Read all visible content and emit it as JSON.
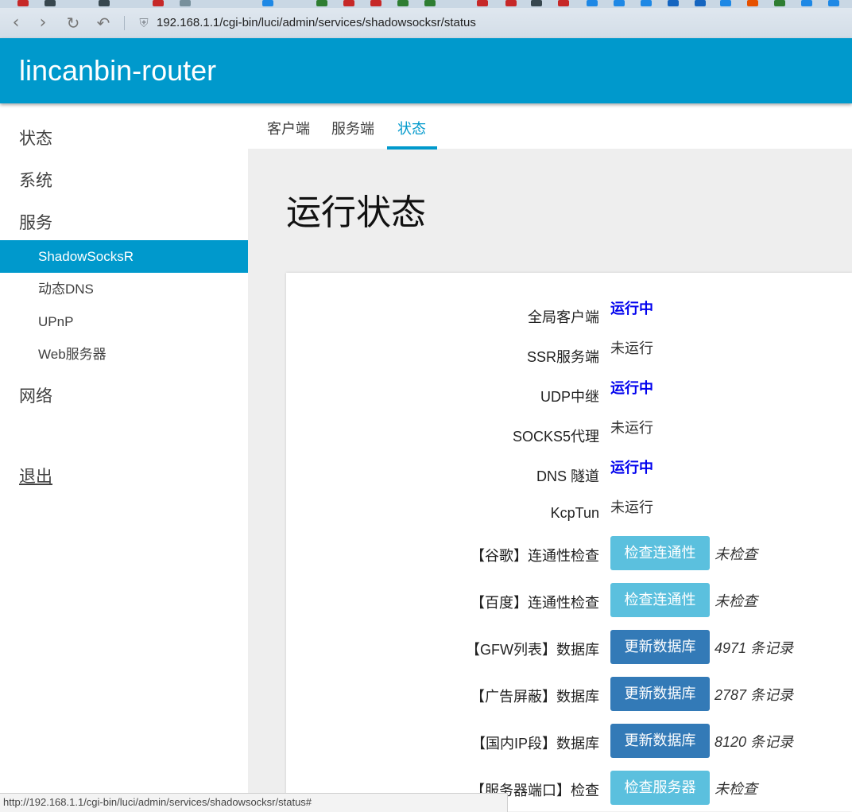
{
  "browser": {
    "url": "192.168.1.1/cgi-bin/luci/admin/services/shadowsocksr/status",
    "status_url": "http://192.168.1.1/cgi-bin/luci/admin/services/shadowsocksr/status#",
    "icons": [
      "back-icon",
      "forward-icon",
      "reload-icon",
      "undo-icon",
      "shield-icon"
    ]
  },
  "header": {
    "brand": "lincanbin-router",
    "color": "#0099cc"
  },
  "sidebar": {
    "items": [
      {
        "label": "状态"
      },
      {
        "label": "系统"
      },
      {
        "label": "服务"
      }
    ],
    "sub_items": [
      {
        "label": "ShadowSocksR",
        "active": true
      },
      {
        "label": "动态DNS"
      },
      {
        "label": "UPnP"
      },
      {
        "label": "Web服务器"
      }
    ],
    "network": "网络",
    "logout": "退出"
  },
  "tabs": [
    {
      "label": "客户端"
    },
    {
      "label": "服务端"
    },
    {
      "label": "状态",
      "active": true
    }
  ],
  "page_title": "运行状态",
  "status_rows": [
    {
      "label": "全局客户端",
      "value": "运行中",
      "state": "running"
    },
    {
      "label": "SSR服务端",
      "value": "未运行",
      "state": "stopped"
    },
    {
      "label": "UDP中继",
      "value": "运行中",
      "state": "running"
    },
    {
      "label": "SOCKS5代理",
      "value": "未运行",
      "state": "stopped"
    },
    {
      "label": "DNS 隧道",
      "value": "运行中",
      "state": "running"
    },
    {
      "label": "KcpTun",
      "value": "未运行",
      "state": "stopped"
    }
  ],
  "action_rows": [
    {
      "label": "【谷歌】连通性检查",
      "button": "检查连通性",
      "note": "未检查",
      "style": "info"
    },
    {
      "label": "【百度】连通性检查",
      "button": "检查连通性",
      "note": "未检查",
      "style": "info"
    },
    {
      "label": "【GFW列表】数据库",
      "button": "更新数据库",
      "note": "4971 条记录",
      "style": "primary"
    },
    {
      "label": "【广告屏蔽】数据库",
      "button": "更新数据库",
      "note": "2787 条记录",
      "style": "primary"
    },
    {
      "label": "【国内IP段】数据库",
      "button": "更新数据库",
      "note": "8120 条记录",
      "style": "primary"
    },
    {
      "label": "【服务器端口】检查",
      "button": "检查服务器",
      "note": "未检查",
      "style": "info"
    }
  ]
}
